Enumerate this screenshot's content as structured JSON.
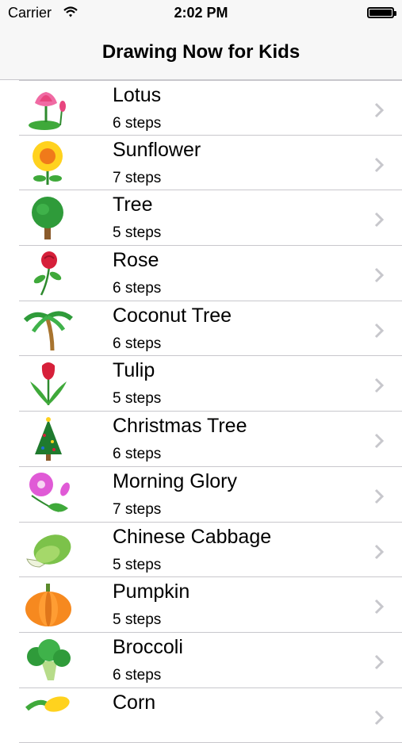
{
  "status": {
    "carrier": "Carrier",
    "time": "2:02 PM"
  },
  "nav": {
    "title": "Drawing Now for Kids"
  },
  "items": [
    {
      "name": "Lotus",
      "steps": "6 steps",
      "icon": "lotus-icon"
    },
    {
      "name": "Sunflower",
      "steps": "7 steps",
      "icon": "sunflower-icon"
    },
    {
      "name": "Tree",
      "steps": "5 steps",
      "icon": "tree-icon"
    },
    {
      "name": "Rose",
      "steps": "6 steps",
      "icon": "rose-icon"
    },
    {
      "name": "Coconut Tree",
      "steps": "6 steps",
      "icon": "coconut-tree-icon"
    },
    {
      "name": "Tulip",
      "steps": "5 steps",
      "icon": "tulip-icon"
    },
    {
      "name": "Christmas Tree",
      "steps": "6 steps",
      "icon": "christmas-tree-icon"
    },
    {
      "name": "Morning Glory",
      "steps": "7 steps",
      "icon": "morning-glory-icon"
    },
    {
      "name": "Chinese Cabbage",
      "steps": "5 steps",
      "icon": "chinese-cabbage-icon"
    },
    {
      "name": "Pumpkin",
      "steps": "5 steps",
      "icon": "pumpkin-icon"
    },
    {
      "name": "Broccoli",
      "steps": "6 steps",
      "icon": "broccoli-icon"
    },
    {
      "name": "Corn",
      "steps": "",
      "icon": "corn-icon"
    }
  ]
}
